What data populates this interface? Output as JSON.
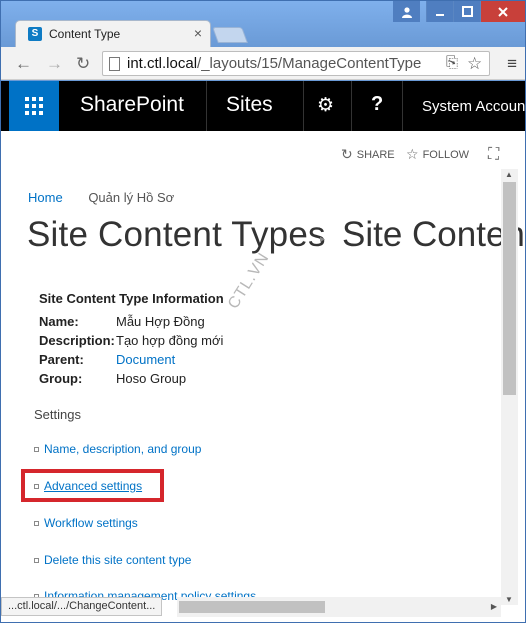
{
  "browser": {
    "tab_title": "Content Type",
    "tab_close": "×",
    "url_host": "int.ctl.local",
    "url_path": "/_layouts/15/ManageContentType",
    "back_glyph": "←",
    "forward_glyph": "→",
    "reload_glyph": "↻",
    "menu_glyph": "≡",
    "star_glyph": "☆",
    "translate_glyph": "⎘",
    "window_buttons": {
      "user": "👤",
      "minimize": "▁",
      "maximize": "□",
      "close": "✕"
    },
    "status_text": "...ctl.local/.../ChangeContent..."
  },
  "suite_bar": {
    "brand": "SharePoint",
    "sites": "Sites",
    "gear_glyph": "⚙",
    "help_glyph": "?",
    "account": "System Account",
    "color": "#000000",
    "waffle_color": "#0072c6"
  },
  "page_actions": {
    "share_label": "SHARE",
    "follow_label": "FOLLOW",
    "share_glyph": "↻",
    "follow_glyph": "☆",
    "focus_glyph": "⛶"
  },
  "breadcrumb": {
    "home": "Home",
    "site": "Quản lý Hồ Sơ"
  },
  "title": {
    "main": "Site Content Types",
    "arrow": "▸",
    "sub": "Site Content"
  },
  "info": {
    "heading": "Site Content Type Information",
    "rows": [
      {
        "label": "Name:",
        "value": "Mẫu Hợp Đồng"
      },
      {
        "label": "Description:",
        "value": "Tạo hợp đồng mới"
      },
      {
        "label": "Parent:",
        "value": "Document"
      },
      {
        "label": "Group:",
        "value": "Hoso Group"
      }
    ]
  },
  "watermark": "CTL.VN",
  "settings": {
    "label": "Settings",
    "items": [
      "Name, description, and group",
      "Advanced settings",
      "Workflow settings",
      "Delete this site content type",
      "Information management policy settings"
    ]
  },
  "colors": {
    "link": "#0072c6",
    "highlight": "#d5262c",
    "window_frame": "#6a9ad6"
  }
}
